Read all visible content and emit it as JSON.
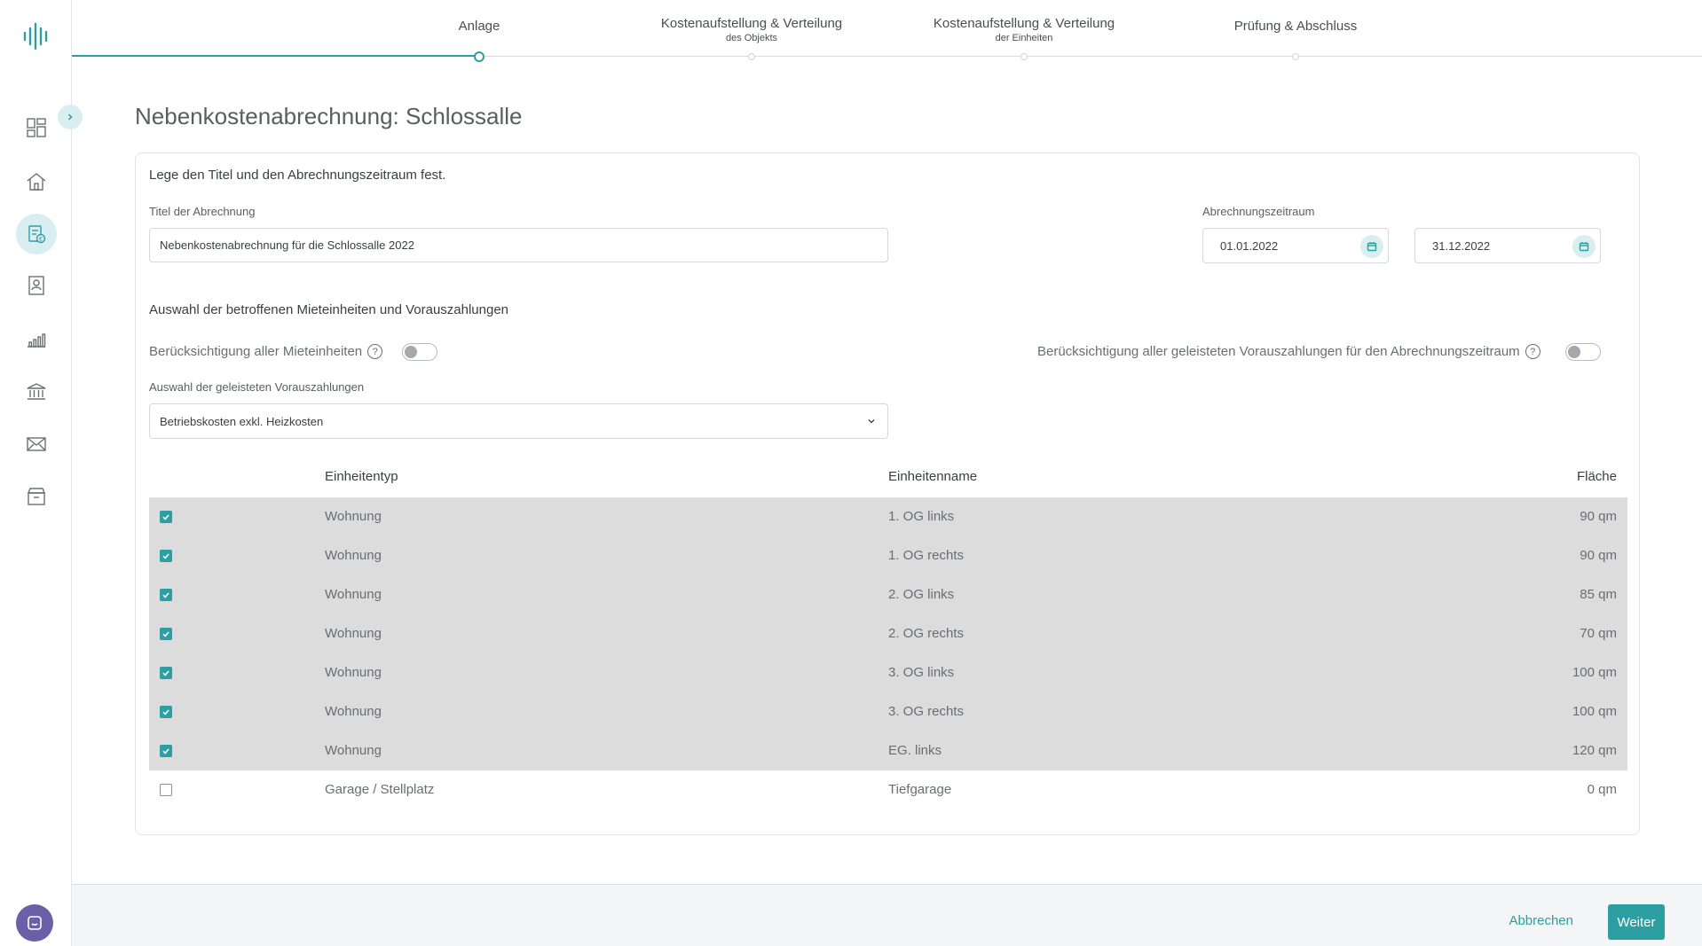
{
  "colors": {
    "accent": "#2d9ea1",
    "accent_light": "#d9eef0",
    "selected_row": "#dcdcdc",
    "chat": "#6b5fa8"
  },
  "sidebar": {
    "icons": [
      "logo-icon",
      "dashboard-icon",
      "home-icon",
      "billing-icon",
      "contacts-icon",
      "chart-icon",
      "bank-icon",
      "mail-icon",
      "archive-icon"
    ]
  },
  "stepper": {
    "steps": [
      {
        "label": "Anlage",
        "sub": ""
      },
      {
        "label": "Kostenaufstellung & Verteilung",
        "sub": "des Objekts"
      },
      {
        "label": "Kostenaufstellung & Verteilung",
        "sub": "der Einheiten"
      },
      {
        "label": "Prüfung & Abschluss",
        "sub": ""
      }
    ]
  },
  "page": {
    "title": "Nebenkostenabrechnung: Schlossalle"
  },
  "form": {
    "section1": "Lege den Titel und den Abrechnungszeitraum fest.",
    "title_label": "Titel der Abrechnung",
    "title_value": "Nebenkostenabrechnung für die Schlossalle 2022",
    "period_label": "Abrechnungszeitraum",
    "date_from": "01.01.2022",
    "date_to": "31.12.2022",
    "section2": "Auswahl der betroffenen Mieteinheiten und Vorauszahlungen",
    "toggle_units_label": "Berücksichtigung aller Mieteinheiten",
    "toggle_payments_label": "Berücksichtigung aller geleisteten Vorauszahlungen für den Abrechnungszeitraum",
    "help_glyph": "?",
    "payments_label": "Auswahl der geleisteten Vorauszahlungen",
    "payments_value": "Betriebskosten exkl. Heizkosten"
  },
  "table": {
    "headers": {
      "typ": "Einheitentyp",
      "name": "Einheitenname",
      "flaeche": "Fläche"
    },
    "rows": [
      {
        "checked": true,
        "typ": "Wohnung",
        "name": "1. OG links",
        "flaeche": "90 qm"
      },
      {
        "checked": true,
        "typ": "Wohnung",
        "name": "1. OG rechts",
        "flaeche": "90 qm"
      },
      {
        "checked": true,
        "typ": "Wohnung",
        "name": "2. OG links",
        "flaeche": "85 qm"
      },
      {
        "checked": true,
        "typ": "Wohnung",
        "name": "2. OG rechts",
        "flaeche": "70 qm"
      },
      {
        "checked": true,
        "typ": "Wohnung",
        "name": "3. OG links",
        "flaeche": "100 qm"
      },
      {
        "checked": true,
        "typ": "Wohnung",
        "name": "3. OG rechts",
        "flaeche": "100 qm"
      },
      {
        "checked": true,
        "typ": "Wohnung",
        "name": "EG. links",
        "flaeche": "120 qm"
      },
      {
        "checked": false,
        "typ": "Garage / Stellplatz",
        "name": "Tiefgarage",
        "flaeche": "0 qm"
      }
    ]
  },
  "footer": {
    "cancel": "Abbrechen",
    "next": "Weiter"
  }
}
